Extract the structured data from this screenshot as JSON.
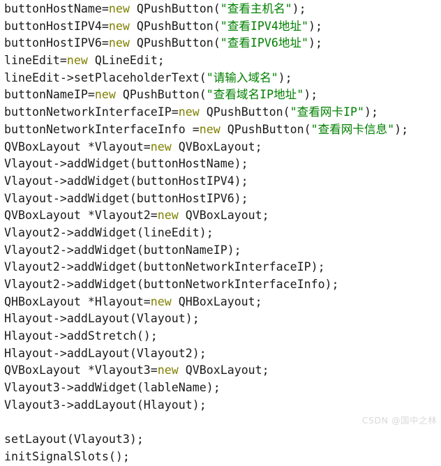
{
  "editor": {
    "background_color": "#ffffff",
    "default_text_color": "#1a1a1a",
    "keyword_color": "#808000",
    "string_color": "#008000",
    "font_size_px": 16.6,
    "line_height_px": 24.7,
    "language": "cpp"
  },
  "code": {
    "lines": [
      {
        "index": 0,
        "text": "buttonHostName=new QPushButton(\"查看主机名\");",
        "tokens": [
          {
            "t": "buttonHostName=",
            "k": "plain"
          },
          {
            "t": "new",
            "k": "keyword"
          },
          {
            "t": " QPushButton(",
            "k": "plain"
          },
          {
            "t": "\"查看主机名\"",
            "k": "string"
          },
          {
            "t": ");",
            "k": "plain"
          }
        ]
      },
      {
        "index": 1,
        "text": "buttonHostIPV4=new QPushButton(\"查看IPV4地址\");",
        "tokens": [
          {
            "t": "buttonHostIPV4=",
            "k": "plain"
          },
          {
            "t": "new",
            "k": "keyword"
          },
          {
            "t": " QPushButton(",
            "k": "plain"
          },
          {
            "t": "\"查看IPV4地址\"",
            "k": "string"
          },
          {
            "t": ");",
            "k": "plain"
          }
        ]
      },
      {
        "index": 2,
        "text": "buttonHostIPV6=new QPushButton(\"查看IPV6地址\");",
        "tokens": [
          {
            "t": "buttonHostIPV6=",
            "k": "plain"
          },
          {
            "t": "new",
            "k": "keyword"
          },
          {
            "t": " QPushButton(",
            "k": "plain"
          },
          {
            "t": "\"查看IPV6地址\"",
            "k": "string"
          },
          {
            "t": ");",
            "k": "plain"
          }
        ]
      },
      {
        "index": 3,
        "text": "lineEdit=new QLineEdit;",
        "tokens": [
          {
            "t": "lineEdit=",
            "k": "plain"
          },
          {
            "t": "new",
            "k": "keyword"
          },
          {
            "t": " QLineEdit;",
            "k": "plain"
          }
        ]
      },
      {
        "index": 4,
        "text": "lineEdit->setPlaceholderText(\"请输入域名\");",
        "tokens": [
          {
            "t": "lineEdit->setPlaceholderText(",
            "k": "plain"
          },
          {
            "t": "\"请输入域名\"",
            "k": "string"
          },
          {
            "t": ");",
            "k": "plain"
          }
        ]
      },
      {
        "index": 5,
        "text": "buttonNameIP=new QPushButton(\"查看域名IP地址\");",
        "tokens": [
          {
            "t": "buttonNameIP=",
            "k": "plain"
          },
          {
            "t": "new",
            "k": "keyword"
          },
          {
            "t": " QPushButton(",
            "k": "plain"
          },
          {
            "t": "\"查看域名IP地址\"",
            "k": "string"
          },
          {
            "t": ");",
            "k": "plain"
          }
        ]
      },
      {
        "index": 6,
        "text": "buttonNetworkInterfaceIP=new QPushButton(\"查看网卡IP\");",
        "tokens": [
          {
            "t": "buttonNetworkInterfaceIP=",
            "k": "plain"
          },
          {
            "t": "new",
            "k": "keyword"
          },
          {
            "t": " QPushButton(",
            "k": "plain"
          },
          {
            "t": "\"查看网卡IP\"",
            "k": "string"
          },
          {
            "t": ");",
            "k": "plain"
          }
        ]
      },
      {
        "index": 7,
        "text": "buttonNetworkInterfaceInfo =new QPushButton(\"查看网卡信息\");",
        "tokens": [
          {
            "t": "buttonNetworkInterfaceInfo =",
            "k": "plain"
          },
          {
            "t": "new",
            "k": "keyword"
          },
          {
            "t": " QPushButton(",
            "k": "plain"
          },
          {
            "t": "\"查看网卡信息\"",
            "k": "string"
          },
          {
            "t": ");",
            "k": "plain"
          }
        ]
      },
      {
        "index": 8,
        "text": "QVBoxLayout *Vlayout=new QVBoxLayout;",
        "tokens": [
          {
            "t": "QVBoxLayout *Vlayout=",
            "k": "plain"
          },
          {
            "t": "new",
            "k": "keyword"
          },
          {
            "t": " QVBoxLayout;",
            "k": "plain"
          }
        ]
      },
      {
        "index": 9,
        "text": "Vlayout->addWidget(buttonHostName);",
        "tokens": [
          {
            "t": "Vlayout->addWidget(buttonHostName);",
            "k": "plain"
          }
        ]
      },
      {
        "index": 10,
        "text": "Vlayout->addWidget(buttonHostIPV4);",
        "tokens": [
          {
            "t": "Vlayout->addWidget(buttonHostIPV4);",
            "k": "plain"
          }
        ]
      },
      {
        "index": 11,
        "text": "Vlayout->addWidget(buttonHostIPV6);",
        "tokens": [
          {
            "t": "Vlayout->addWidget(buttonHostIPV6);",
            "k": "plain"
          }
        ]
      },
      {
        "index": 12,
        "text": "QVBoxLayout *Vlayout2=new QVBoxLayout;",
        "tokens": [
          {
            "t": "QVBoxLayout *Vlayout2=",
            "k": "plain"
          },
          {
            "t": "new",
            "k": "keyword"
          },
          {
            "t": " QVBoxLayout;",
            "k": "plain"
          }
        ]
      },
      {
        "index": 13,
        "text": "Vlayout2->addWidget(lineEdit);",
        "tokens": [
          {
            "t": "Vlayout2->addWidget(lineEdit);",
            "k": "plain"
          }
        ]
      },
      {
        "index": 14,
        "text": "Vlayout2->addWidget(buttonNameIP);",
        "tokens": [
          {
            "t": "Vlayout2->addWidget(buttonNameIP);",
            "k": "plain"
          }
        ]
      },
      {
        "index": 15,
        "text": "Vlayout2->addWidget(buttonNetworkInterfaceIP);",
        "tokens": [
          {
            "t": "Vlayout2->addWidget(buttonNetworkInterfaceIP);",
            "k": "plain"
          }
        ]
      },
      {
        "index": 16,
        "text": "Vlayout2->addWidget(buttonNetworkInterfaceInfo);",
        "tokens": [
          {
            "t": "Vlayout2->addWidget(buttonNetworkInterfaceInfo);",
            "k": "plain"
          }
        ]
      },
      {
        "index": 17,
        "text": "QHBoxLayout *Hlayout=new QHBoxLayout;",
        "tokens": [
          {
            "t": "QHBoxLayout *Hlayout=",
            "k": "plain"
          },
          {
            "t": "new",
            "k": "keyword"
          },
          {
            "t": " QHBoxLayout;",
            "k": "plain"
          }
        ]
      },
      {
        "index": 18,
        "text": "Hlayout->addLayout(Vlayout);",
        "tokens": [
          {
            "t": "Hlayout->addLayout(Vlayout);",
            "k": "plain"
          }
        ]
      },
      {
        "index": 19,
        "text": "Hlayout->addStretch();",
        "tokens": [
          {
            "t": "Hlayout->addStretch();",
            "k": "plain"
          }
        ]
      },
      {
        "index": 20,
        "text": "Hlayout->addLayout(Vlayout2);",
        "tokens": [
          {
            "t": "Hlayout->addLayout(Vlayout2);",
            "k": "plain"
          }
        ]
      },
      {
        "index": 21,
        "text": "QVBoxLayout *Vlayout3=new QVBoxLayout;",
        "tokens": [
          {
            "t": "QVBoxLayout *Vlayout3=",
            "k": "plain"
          },
          {
            "t": "new",
            "k": "keyword"
          },
          {
            "t": " QVBoxLayout;",
            "k": "plain"
          }
        ]
      },
      {
        "index": 22,
        "text": "Vlayout3->addWidget(lableName);",
        "tokens": [
          {
            "t": "Vlayout3->addWidget(lableName);",
            "k": "plain"
          }
        ]
      },
      {
        "index": 23,
        "text": "Vlayout3->addLayout(Hlayout);",
        "tokens": [
          {
            "t": "Vlayout3->addLayout(Hlayout);",
            "k": "plain"
          }
        ]
      },
      {
        "index": 24,
        "text": "",
        "tokens": []
      },
      {
        "index": 25,
        "text": "setLayout(Vlayout3);",
        "tokens": [
          {
            "t": "setLayout(Vlayout3);",
            "k": "plain"
          }
        ]
      },
      {
        "index": 26,
        "text": "initSignalSlots();",
        "tokens": [
          {
            "t": "initSignalSlots();",
            "k": "plain"
          }
        ]
      }
    ]
  },
  "watermark": {
    "text": "CSDN @国中之林",
    "color": "#d9d9d9"
  }
}
